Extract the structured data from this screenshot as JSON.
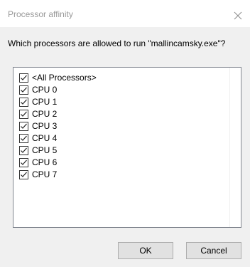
{
  "window": {
    "title": "Processor affinity",
    "close_icon": "close-icon"
  },
  "prompt": "Which processors are allowed to run \"mallincamsky.exe\"?",
  "processors": [
    {
      "label": "<All Processors>",
      "checked": true
    },
    {
      "label": "CPU 0",
      "checked": true
    },
    {
      "label": "CPU 1",
      "checked": true
    },
    {
      "label": "CPU 2",
      "checked": true
    },
    {
      "label": "CPU 3",
      "checked": true
    },
    {
      "label": "CPU 4",
      "checked": true
    },
    {
      "label": "CPU 5",
      "checked": true
    },
    {
      "label": "CPU 6",
      "checked": true
    },
    {
      "label": "CPU 7",
      "checked": true
    }
  ],
  "buttons": {
    "ok_label": "OK",
    "cancel_label": "Cancel"
  },
  "colors": {
    "title_text": "#999999",
    "body_background": "#f0f0f0",
    "button_background": "#e1e1e1",
    "button_border": "#adadad"
  }
}
